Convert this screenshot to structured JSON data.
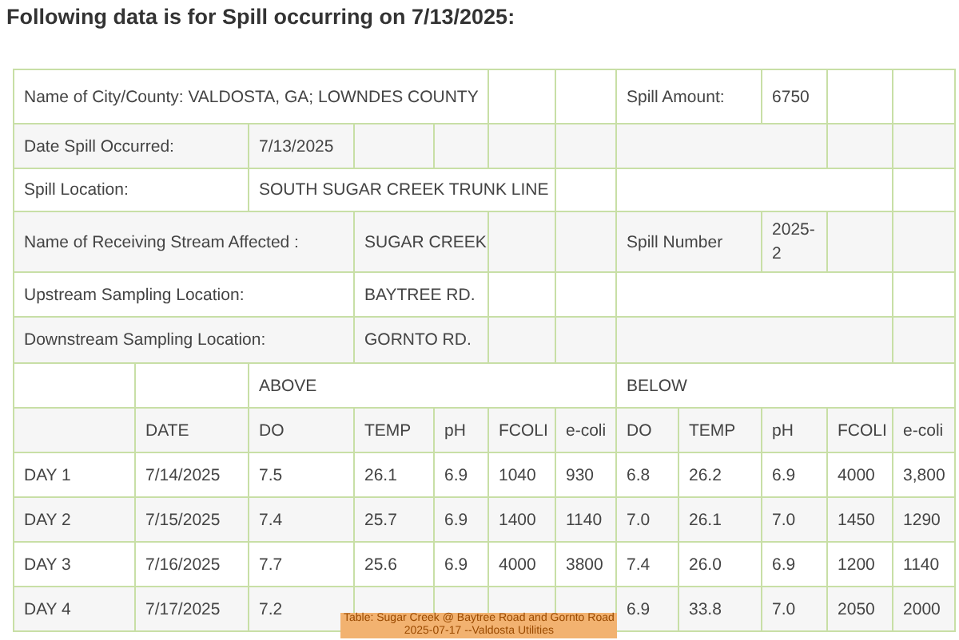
{
  "heading": "Following data is for Spill occurring on 7/13/2025:",
  "city_county": "Name of City/County: VALDOSTA, GA; LOWNDES COUNTY",
  "spill_amount": {
    "label": "Spill Amount:",
    "value": "6750"
  },
  "date_spill": {
    "label": "Date Spill Occurred:",
    "value": "7/13/2025"
  },
  "spill_location": {
    "label": "Spill Location:",
    "value": "SOUTH SUGAR CREEK TRUNK LINE"
  },
  "receiving_stream": {
    "label": "Name of Receiving Stream Affected :",
    "value": "SUGAR CREEK"
  },
  "spill_number": {
    "label": "Spill Number",
    "value": "2025-2"
  },
  "upstream": {
    "label": "Upstream Sampling Location:",
    "value": "BAYTREE RD."
  },
  "downstream": {
    "label": "Downstream Sampling Location:",
    "value": "GORNTO RD."
  },
  "groups": [
    "ABOVE",
    "BELOW"
  ],
  "columns": [
    "DATE",
    "DO",
    "TEMP",
    "pH",
    "FCOLI",
    "e-coli",
    "DO",
    "TEMP",
    "pH",
    "FCOLI",
    "e-coli"
  ],
  "rows": [
    {
      "day": "DAY 1",
      "date": "7/14/2025",
      "above": [
        "7.5",
        "26.1",
        "6.9",
        "1040",
        "930"
      ],
      "below": [
        "6.8",
        "26.2",
        "6.9",
        "4000",
        "3,800"
      ]
    },
    {
      "day": "DAY 2",
      "date": "7/15/2025",
      "above": [
        "7.4",
        "25.7",
        "6.9",
        "1400",
        "1140"
      ],
      "below": [
        "7.0",
        "26.1",
        "7.0",
        "1450",
        "1290"
      ]
    },
    {
      "day": "DAY 3",
      "date": "7/16/2025",
      "above": [
        "7.7",
        "25.6",
        "6.9",
        "4000",
        "3800"
      ],
      "below": [
        "7.4",
        "26.0",
        "6.9",
        "1200",
        "1140"
      ]
    },
    {
      "day": "DAY 4",
      "date": "7/17/2025",
      "above": [
        "7.2"
      ],
      "below": [
        "6.9",
        "33.8",
        "7.0",
        "2050",
        "2000"
      ]
    }
  ],
  "caption": [
    "Table: Sugar Creek @ Baytree Road and Gornto Road",
    "2025-07-17 --Valdosta Utilities"
  ]
}
